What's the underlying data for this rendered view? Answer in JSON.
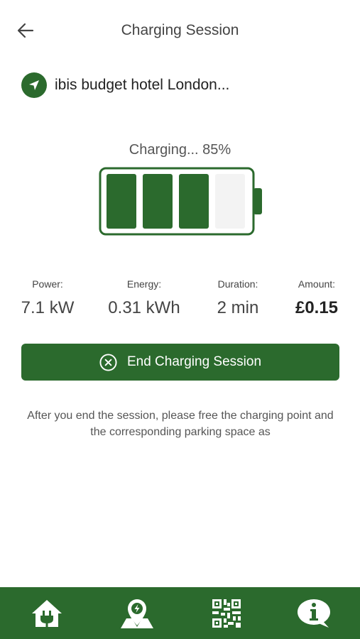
{
  "header": {
    "title": "Charging Session"
  },
  "station": {
    "name": "ibis budget hotel London..."
  },
  "charging": {
    "status_text": "Charging... 85%",
    "percent": 85,
    "bars_filled": 3,
    "bars_total": 4
  },
  "stats": {
    "power": {
      "label": "Power:",
      "value": "7.1 kW"
    },
    "energy": {
      "label": "Energy:",
      "value": "0.31 kWh"
    },
    "duration": {
      "label": "Duration:",
      "value": "2 min"
    },
    "amount": {
      "label": "Amount:",
      "value": "£0.15"
    }
  },
  "end_button": {
    "label": "End Charging Session"
  },
  "note": {
    "text": "After you end the session, please free the charging point and the corresponding parking space as"
  },
  "bottom_nav": [
    {
      "icon": "home-plug-icon"
    },
    {
      "icon": "map-charge-icon"
    },
    {
      "icon": "qr-code-icon"
    },
    {
      "icon": "info-chat-icon"
    }
  ],
  "colors": {
    "primary": "#2b6a2d",
    "empty_cell": "#f3f3f3"
  }
}
